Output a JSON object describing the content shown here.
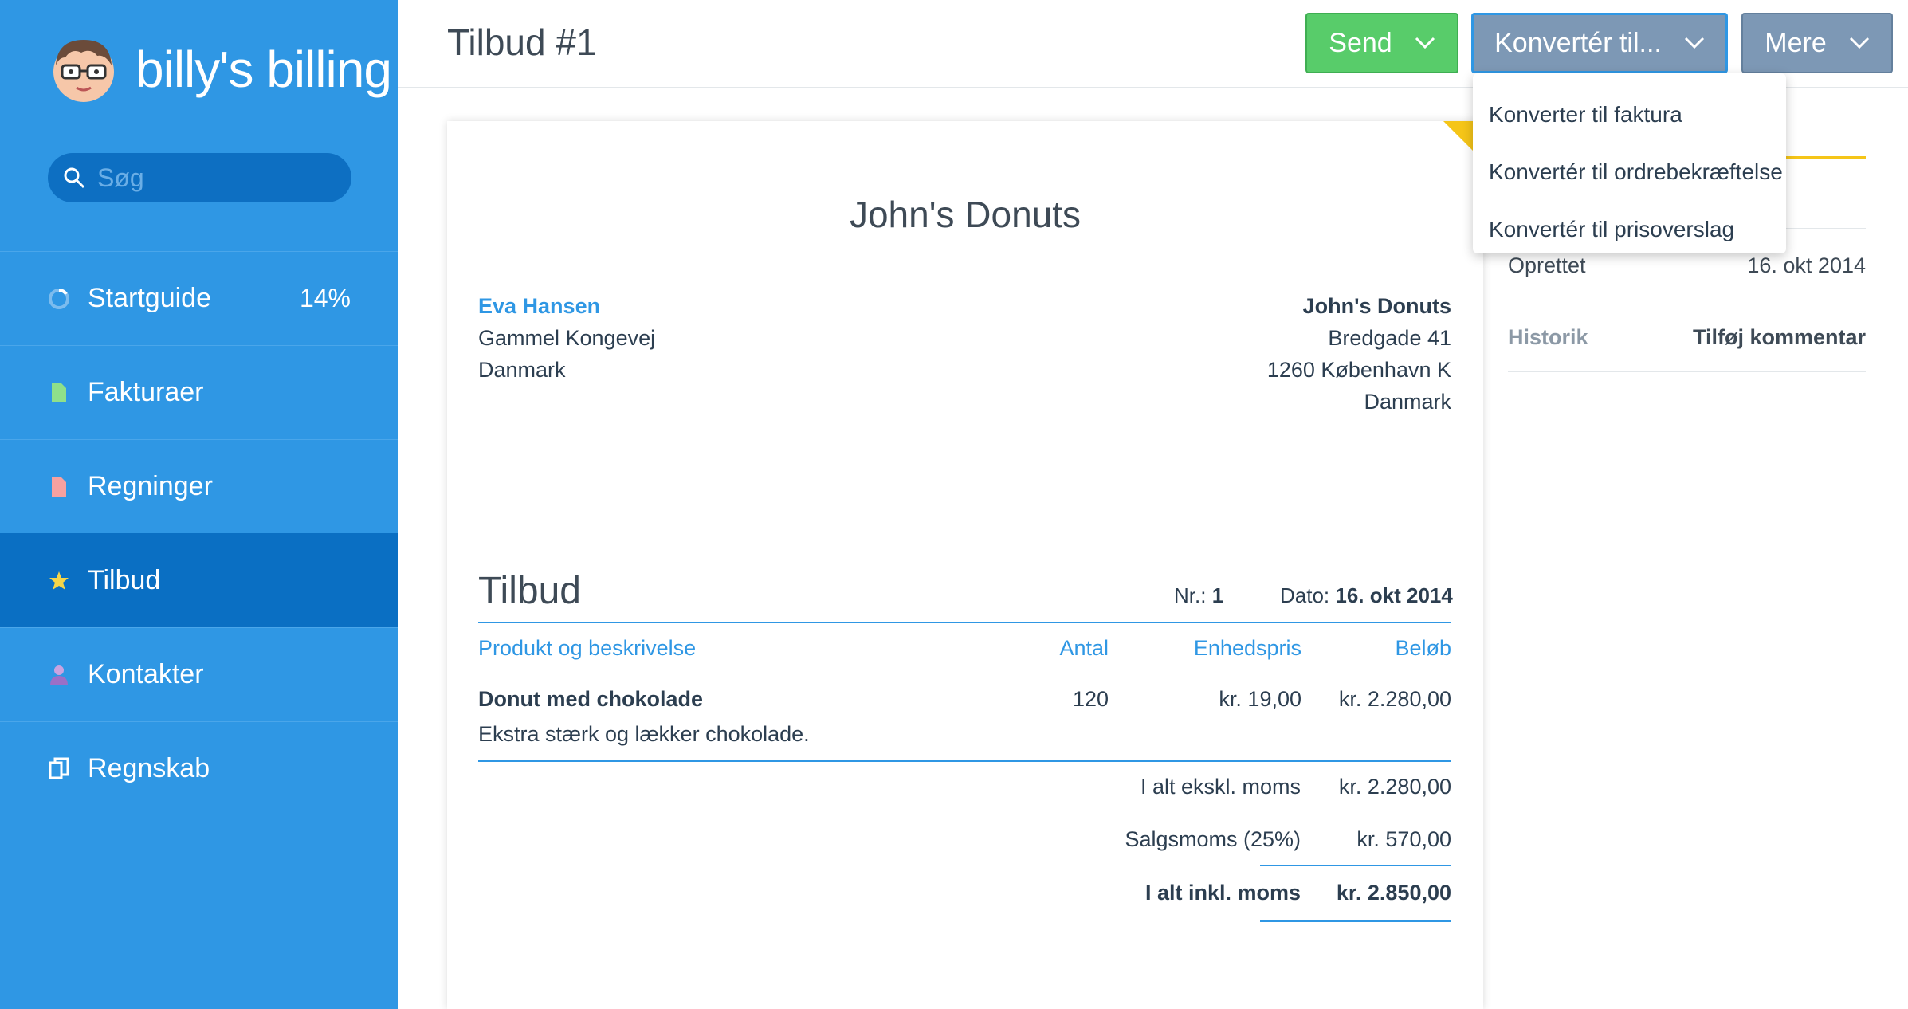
{
  "app": {
    "logo_text": "billy's billing"
  },
  "sidebar": {
    "search_placeholder": "Søg",
    "items": [
      {
        "label": "Startguide",
        "badge": "14%"
      },
      {
        "label": "Fakturaer"
      },
      {
        "label": "Regninger"
      },
      {
        "label": "Tilbud",
        "active": true
      },
      {
        "label": "Kontakter"
      },
      {
        "label": "Regnskab"
      }
    ]
  },
  "header": {
    "title": "Tilbud #1",
    "send_label": "Send",
    "convert_label": "Konvertér til...",
    "more_label": "Mere"
  },
  "dropdown": {
    "items": [
      "Konverter til faktura",
      "Konvertér til ordrebekræftelse",
      "Konvertér til prisoverslag"
    ]
  },
  "document": {
    "company": "John's Donuts",
    "recipient": {
      "name": "Eva Hansen",
      "street": "Gammel Kongevej",
      "country": "Danmark"
    },
    "sender": {
      "name": "John's Donuts",
      "street": "Bredgade 41",
      "city": "1260 København K",
      "country": "Danmark"
    },
    "heading": "Tilbud",
    "number_label": "Nr.:",
    "number": "1",
    "date_label": "Dato:",
    "date": "16. okt 2014",
    "columns": {
      "product": "Produkt og beskrivelse",
      "qty": "Antal",
      "unit": "Enhedspris",
      "amount": "Beløb"
    },
    "lines": [
      {
        "product": "Donut med chokolade",
        "description": "Ekstra stærk og lækker chokolade.",
        "qty": "120",
        "unit": "kr. 19,00",
        "amount": "kr. 2.280,00"
      }
    ],
    "totals": {
      "subtotal_label": "I alt ekskl. moms",
      "subtotal": "kr. 2.280,00",
      "vat_label": "Salgsmoms (25%)",
      "vat": "kr. 570,00",
      "total_label": "I alt inkl. moms",
      "total": "kr. 2.850,00"
    }
  },
  "info_panel": {
    "created_label": "Oprettet",
    "created_value": "16. okt 2014",
    "history_label": "Historik",
    "add_comment": "Tilføj kommentar"
  },
  "colors": {
    "sidebar": "#2f97e4",
    "sidebar_active": "#0a6fc3",
    "send": "#58cc6a",
    "convert": "#7d98b5",
    "accent": "#2f97e4",
    "corner": "#f5c518"
  }
}
